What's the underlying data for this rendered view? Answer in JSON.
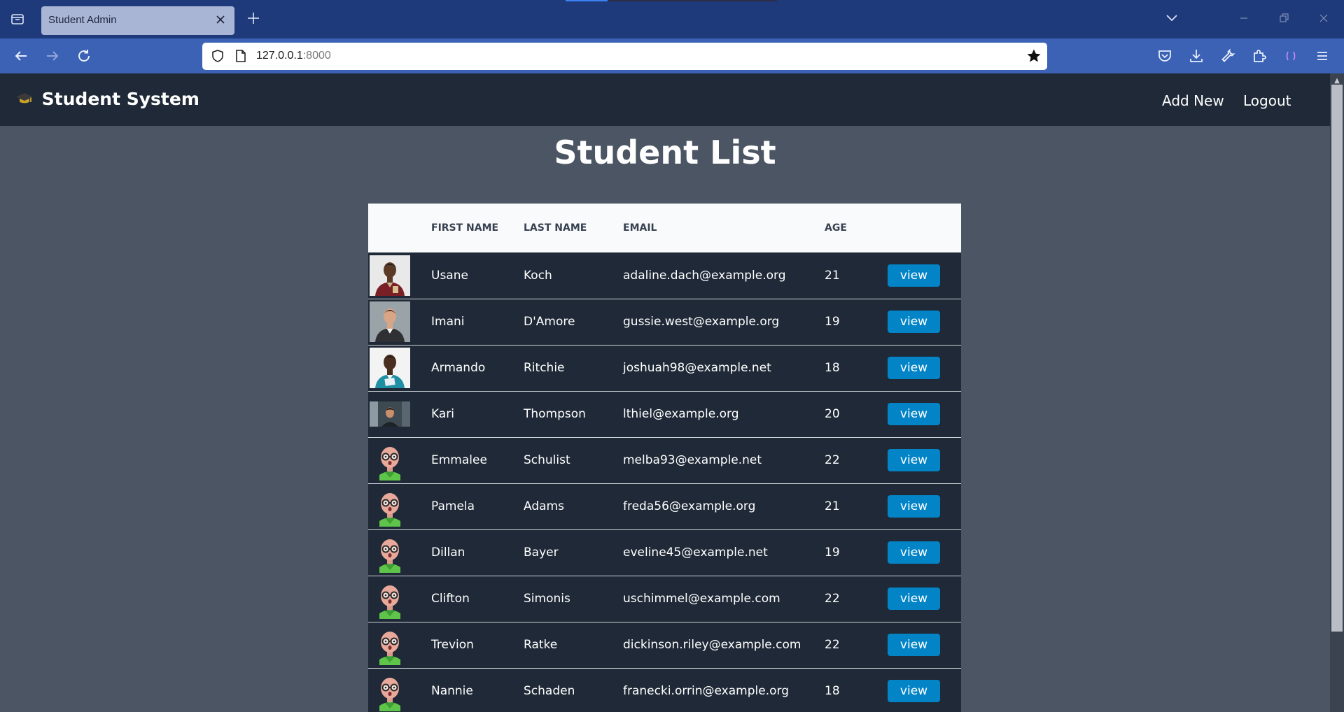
{
  "browser": {
    "tab_title": "Student Admin",
    "url_host": "127.0.0.1",
    "url_port": ":8000"
  },
  "site": {
    "brand": "Student System",
    "nav": [
      "Add New",
      "Logout"
    ]
  },
  "page": {
    "title": "Student List"
  },
  "table": {
    "headers": {
      "first": "FIRST NAME",
      "last": "LAST NAME",
      "email": "EMAIL",
      "age": "AGE"
    },
    "action_label": "view",
    "rows": [
      {
        "first": "Usane",
        "last": "Koch",
        "email": "adaline.dach@example.org",
        "age": "21",
        "photo": "photo-man-maroon"
      },
      {
        "first": "Imani",
        "last": "D'Amore",
        "email": "gussie.west@example.org",
        "age": "19",
        "photo": "photo-man-suit"
      },
      {
        "first": "Armando",
        "last": "Ritchie",
        "email": "joshuah98@example.net",
        "age": "18",
        "photo": "photo-student-teal"
      },
      {
        "first": "Kari",
        "last": "Thompson",
        "email": "lthiel@example.org",
        "age": "20",
        "photo": "photo-man-street"
      },
      {
        "first": "Emmalee",
        "last": "Schulist",
        "email": "melba93@example.net",
        "age": "22",
        "photo": "cartoon-avatar"
      },
      {
        "first": "Pamela",
        "last": "Adams",
        "email": "freda56@example.org",
        "age": "21",
        "photo": "cartoon-avatar"
      },
      {
        "first": "Dillan",
        "last": "Bayer",
        "email": "eveline45@example.net",
        "age": "19",
        "photo": "cartoon-avatar"
      },
      {
        "first": "Clifton",
        "last": "Simonis",
        "email": "uschimmel@example.com",
        "age": "22",
        "photo": "cartoon-avatar"
      },
      {
        "first": "Trevion",
        "last": "Ratke",
        "email": "dickinson.riley@example.com",
        "age": "22",
        "photo": "cartoon-avatar"
      },
      {
        "first": "Nannie",
        "last": "Schaden",
        "email": "franecki.orrin@example.org",
        "age": "18",
        "photo": "cartoon-avatar"
      }
    ]
  },
  "icons": {
    "tab_list": "tab-list-icon",
    "close": "close-icon",
    "new_tab": "plus-icon",
    "back": "back-arrow-icon",
    "forward": "forward-arrow-icon",
    "reload": "reload-icon",
    "shield": "shield-icon",
    "page": "page-icon",
    "bookmark": "star-icon",
    "pocket": "pocket-icon",
    "downloads": "download-icon",
    "tools": "wrench-icon",
    "extensions": "puzzle-icon",
    "container": "container-icon",
    "menu": "hamburger-menu-icon",
    "graduation": "graduation-cap-icon"
  },
  "colors": {
    "browser_tabbar": "#1f3a7a",
    "browser_navbar": "#3b62b5",
    "site_nav": "#1f2937",
    "page_bg": "#4b5563",
    "table_header": "#f9fafb",
    "row_bg": "#1f2937",
    "button": "#0284c7"
  }
}
